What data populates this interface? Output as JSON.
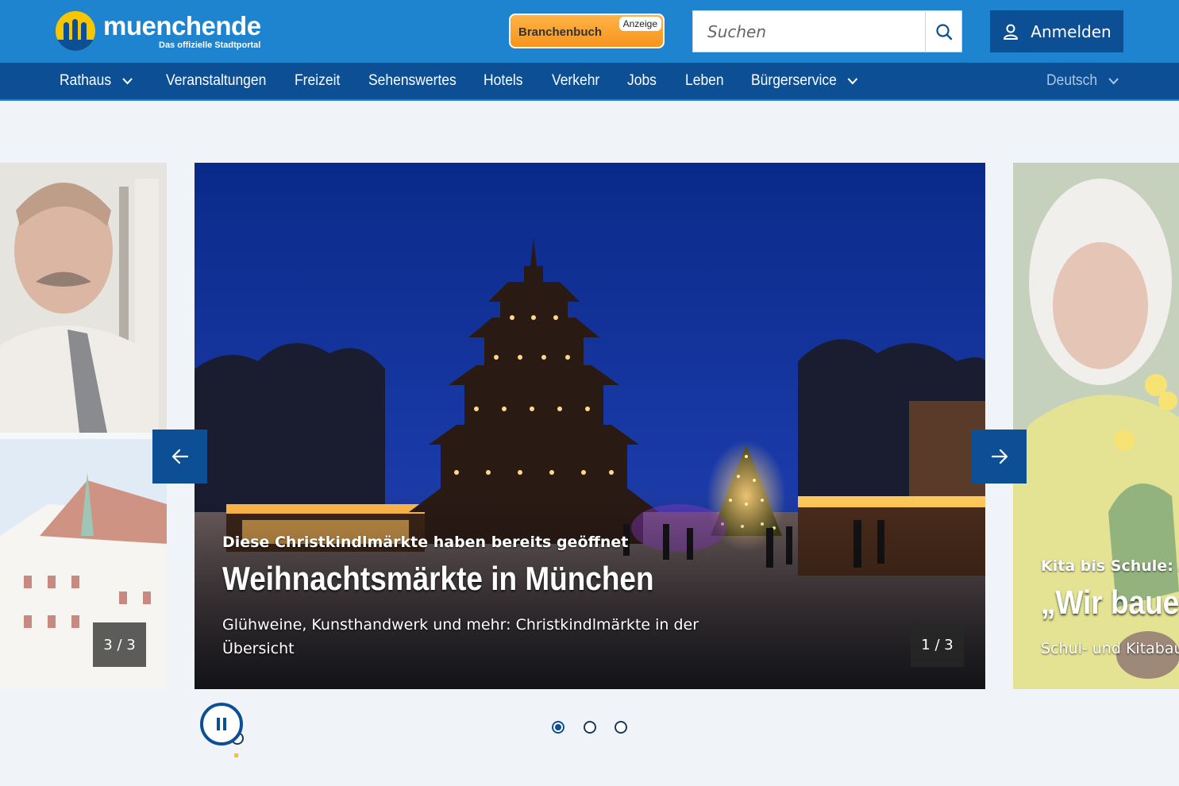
{
  "header": {
    "logo_text": "muenchen",
    "logo_dot": ".",
    "logo_tld": "de",
    "logo_tagline": "Das offizielle Stadtportal",
    "branchenbuch_label": "Branchenbuch",
    "ad_label": "Anzeige",
    "search_placeholder": "Suchen",
    "login_label": "Anmelden"
  },
  "nav": {
    "items": [
      {
        "label": "Rathaus",
        "dropdown": true
      },
      {
        "label": "Veranstaltungen",
        "dropdown": false
      },
      {
        "label": "Freizeit",
        "dropdown": false
      },
      {
        "label": "Sehenswertes",
        "dropdown": false
      },
      {
        "label": "Hotels",
        "dropdown": false
      },
      {
        "label": "Verkehr",
        "dropdown": false
      },
      {
        "label": "Jobs",
        "dropdown": false
      },
      {
        "label": "Leben",
        "dropdown": false
      },
      {
        "label": "Bürgerservice",
        "dropdown": true
      }
    ],
    "language": "Deutsch"
  },
  "carousel": {
    "current": {
      "kicker": "Diese Christkindlmärkte haben bereits geöffnet",
      "title": "Weihnachtsmärkte in München",
      "text": "Glühweine, Kunsthandwerk und mehr: Christkindlmärkte in der Übersicht",
      "counter": "1 / 3"
    },
    "previous": {
      "counter": "3 / 3"
    },
    "next": {
      "kicker": "Kita bis Schule: Al",
      "title": "„Wir bauer",
      "text": "Schul- und Kitabau"
    },
    "slide_count": 3,
    "active_index": 1
  },
  "colors": {
    "header_blue": "#1f84cf",
    "nav_blue": "#0d4f94",
    "logo_yellow": "#f7c600",
    "branchenbuch_orange": "#f7941d"
  }
}
